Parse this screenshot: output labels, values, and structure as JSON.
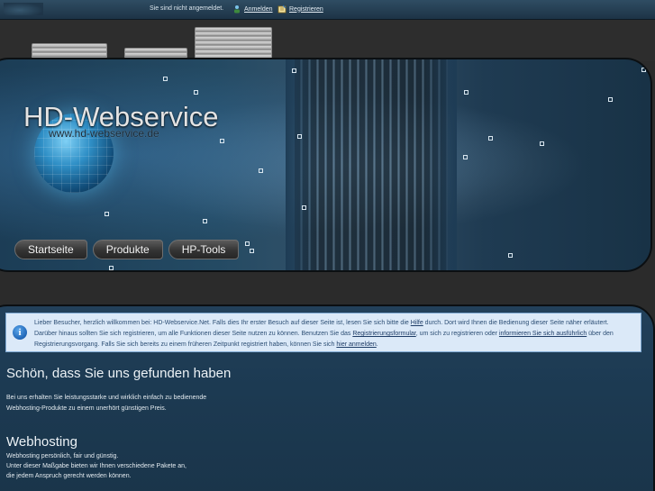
{
  "topbar": {
    "status": "Sie sind nicht angemeldet.",
    "login_label": "Anmelden",
    "register_label": "Registrieren"
  },
  "header": {
    "brand": "HD-Webservice",
    "url": "www.hd-webservice.de"
  },
  "nav": {
    "items": [
      "Startseite",
      "Produkte",
      "HP-Tools"
    ]
  },
  "infobox": {
    "seg1": "Lieber Besucher, herzlich willkommen bei: HD-Webservice.Net. Falls dies Ihr erster Besuch auf dieser Seite ist, lesen Sie sich bitte die ",
    "link_help": "Hilfe",
    "seg2": " durch. Dort wird Ihnen die Bedienung dieser Seite näher erläutert. Darüber hinaus sollten Sie sich registrieren, um alle Funktionen dieser Seite nutzen zu können. Benutzen Sie das ",
    "link_form": "Registrierungsformular",
    "seg3": ", um sich zu registrieren oder ",
    "link_info": "informieren Sie sich ausführlich",
    "seg4": " über den Registrierungsvorgang. Falls Sie sich bereits zu einem früheren Zeitpunkt registriert haben, können Sie sich ",
    "link_login": "hier anmelden",
    "seg5": "."
  },
  "section1": {
    "title": "Schön, dass Sie uns gefunden haben",
    "line1": "Bei uns erhalten Sie leistungsstarke und wirklich einfach zu bedienende",
    "line2": "Webhosting-Produkte zu einem unerhört günstigen Preis."
  },
  "section2": {
    "title": "Webhosting",
    "line1": "Webhosting persönlich, fair und günstig.",
    "line2": "Unter dieser Maßgabe bieten wir Ihnen verschiedene Pakete an,",
    "line3": "die jedem Anspruch gerecht werden können."
  },
  "colors": {
    "topbar": "#2f4d63",
    "hero": "#244a63",
    "infobox_bg": "#dbe9f8",
    "infobox_text": "#2c4e74",
    "content_bg": "#1c3a52"
  }
}
